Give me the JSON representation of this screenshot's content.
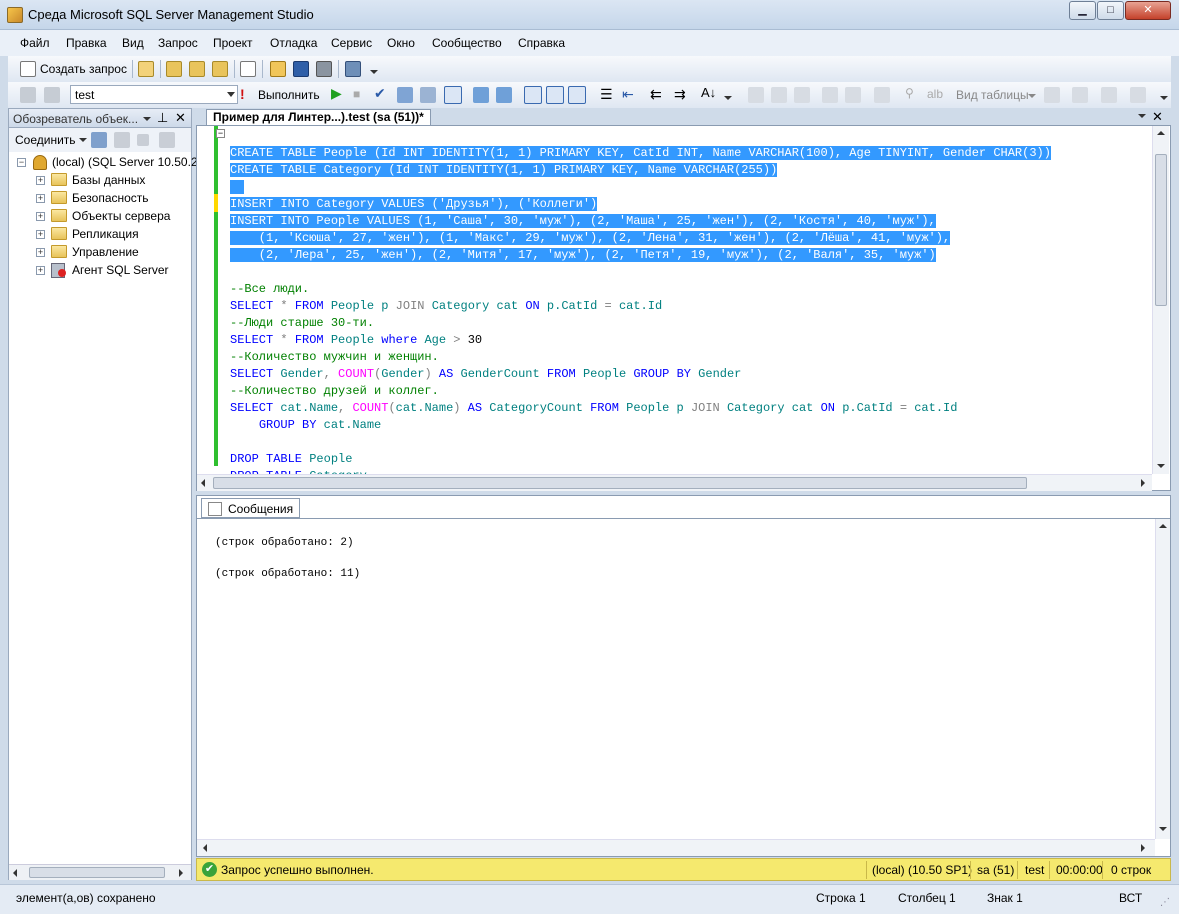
{
  "window": {
    "title": "Среда Microsoft SQL Server Management Studio",
    "minimize": "▁",
    "maximize": "□",
    "close": "✕"
  },
  "menu": [
    "Файл",
    "Правка",
    "Вид",
    "Запрос",
    "Проект",
    "Отладка",
    "Сервис",
    "Окно",
    "Сообщество",
    "Справка"
  ],
  "toolbar1": {
    "new_query": "Создать запрос"
  },
  "toolbar2": {
    "database": "test",
    "execute": "Выполнить",
    "table_view": "Вид таблицы"
  },
  "object_explorer": {
    "title": "Обозреватель объек...",
    "connect": "Соединить",
    "server": "(local) (SQL Server 10.50.2",
    "nodes": [
      "Базы данных",
      "Безопасность",
      "Объекты сервера",
      "Репликация",
      "Управление",
      "Агент SQL Server"
    ]
  },
  "editor": {
    "tab_title": "Пример для Линтер...).test (sa (51))*",
    "lines": [
      "CREATE TABLE People (Id INT IDENTITY(1, 1) PRIMARY KEY, CatId INT, Name VARCHAR(100), Age TINYINT, Gender CHAR(3))",
      "CREATE TABLE Category (Id INT IDENTITY(1, 1) PRIMARY KEY, Name VARCHAR(255))",
      "",
      "INSERT INTO Category VALUES ('Друзья'), ('Коллеги')",
      "INSERT INTO People VALUES (1, 'Саша', 30, 'муж'), (2, 'Маша', 25, 'жен'), (2, 'Костя', 40, 'муж'),",
      "    (1, 'Ксюша', 27, 'жен'), (1, 'Макс', 29, 'муж'), (2, 'Лена', 31, 'жен'), (2, 'Лёша', 41, 'муж'),",
      "    (2, 'Лера', 25, 'жен'), (2, 'Митя', 17, 'муж'), (2, 'Петя', 19, 'муж'), (2, 'Валя', 35, 'муж')",
      "",
      "--Все люди.",
      "SELECT * FROM People p JOIN Category cat ON p.CatId = cat.Id",
      "--Люди старше 30-ти.",
      "SELECT * FROM People where Age > 30",
      "--Количество мужчин и женщин.",
      "SELECT Gender, COUNT(Gender) AS GenderCount FROM People GROUP BY Gender",
      "--Количество друзей и коллег.",
      "SELECT cat.Name, COUNT(cat.Name) AS CategoryCount FROM People p JOIN Category cat ON p.CatId = cat.Id",
      "    GROUP BY cat.Name",
      "",
      "DROP TABLE People",
      "DROP TABLE Category"
    ]
  },
  "results": {
    "tab": "Сообщения",
    "messages": [
      "(строк обработано: 2)",
      "(строк обработано: 11)"
    ]
  },
  "status": {
    "message": "Запрос успешно выполнен.",
    "server": "(local) (10.50 SP1)",
    "user": "sa (51)",
    "database": "test",
    "time": "00:00:00",
    "rows": "0 строк"
  },
  "bottom": {
    "left": "элемент(а,ов) сохранено",
    "row": "Строка 1",
    "col": "Столбец 1",
    "char": "Знак 1",
    "mode": "ВСТ"
  },
  "colors": {
    "keyword": "#0000ff",
    "identifier": "#008080",
    "function": "#ff00ff",
    "comment": "#008000",
    "selection": "#3399ff",
    "status_bg": "#f5e96e"
  }
}
